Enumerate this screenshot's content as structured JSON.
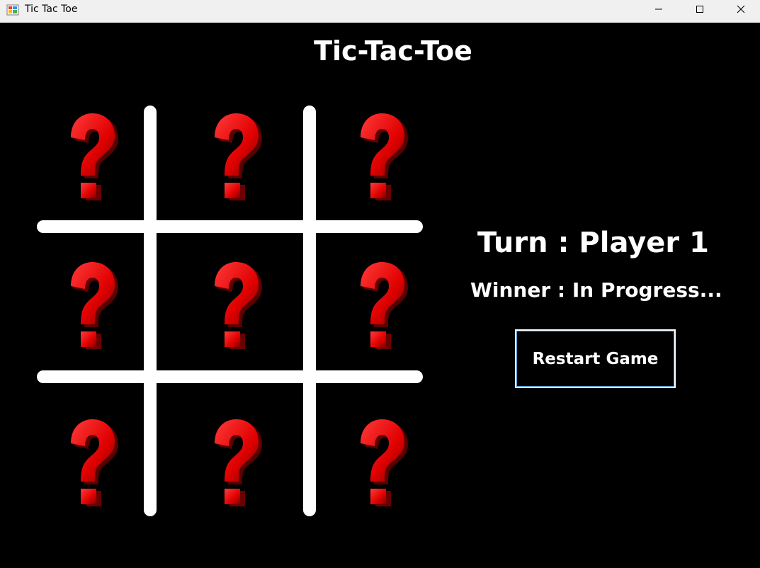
{
  "window": {
    "title": "Tic Tac Toe",
    "controls": [
      "minimize",
      "maximize",
      "close"
    ]
  },
  "game": {
    "heading": "Tic-Tac-Toe",
    "turn_text": "Turn : Player 1",
    "winner_text": "Winner :  In Progress...",
    "restart_label": "Restart Game",
    "cells": [
      {
        "row": 1,
        "col": 1,
        "state": "empty",
        "icon": "question-mark-icon"
      },
      {
        "row": 1,
        "col": 2,
        "state": "empty",
        "icon": "question-mark-icon"
      },
      {
        "row": 1,
        "col": 3,
        "state": "empty",
        "icon": "question-mark-icon"
      },
      {
        "row": 2,
        "col": 1,
        "state": "empty",
        "icon": "question-mark-icon"
      },
      {
        "row": 2,
        "col": 2,
        "state": "empty",
        "icon": "question-mark-icon"
      },
      {
        "row": 2,
        "col": 3,
        "state": "empty",
        "icon": "question-mark-icon"
      },
      {
        "row": 3,
        "col": 1,
        "state": "empty",
        "icon": "question-mark-icon"
      },
      {
        "row": 3,
        "col": 2,
        "state": "empty",
        "icon": "question-mark-icon"
      },
      {
        "row": 3,
        "col": 3,
        "state": "empty",
        "icon": "question-mark-icon"
      }
    ]
  },
  "colors": {
    "background": "#000000",
    "grid_lines": "#ffffff",
    "question_mark": "#e00000",
    "text": "#ffffff",
    "button_focus": "#3b8fd6"
  }
}
